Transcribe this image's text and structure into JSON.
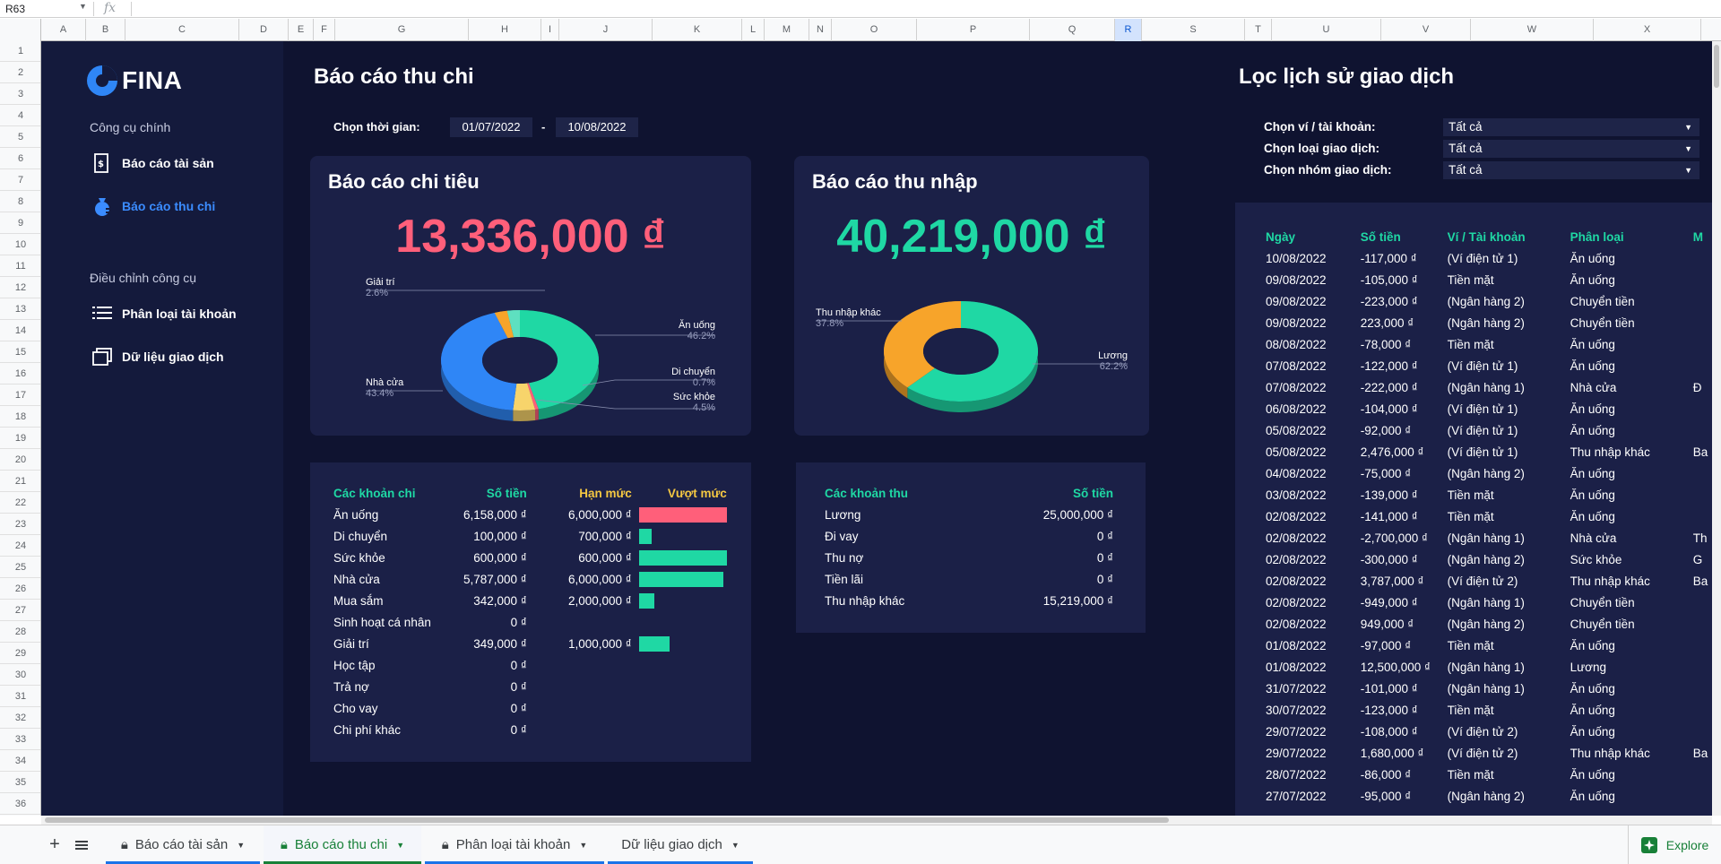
{
  "formula_bar": {
    "cell_ref": "R63",
    "fx": "fx"
  },
  "columns": [
    "A",
    "B",
    "C",
    "D",
    "E",
    "F",
    "G",
    "H",
    "I",
    "J",
    "K",
    "L",
    "M",
    "N",
    "O",
    "P",
    "Q",
    "R",
    "S",
    "T",
    "U",
    "V",
    "W",
    "X"
  ],
  "rows": [
    "1",
    "2",
    "3",
    "4",
    "5",
    "6",
    "7",
    "8",
    "9",
    "10",
    "11",
    "12",
    "13",
    "14",
    "15",
    "16",
    "17",
    "18",
    "19",
    "20",
    "21",
    "22",
    "23",
    "24",
    "25",
    "26",
    "27",
    "28",
    "29",
    "30",
    "31",
    "32",
    "33",
    "34",
    "35",
    "36"
  ],
  "sidebar": {
    "logo": "FINA",
    "section1": "Công cụ chính",
    "item_assets": "Báo cáo tài sản",
    "item_income_expense": "Báo cáo thu chi",
    "section2": "Điều chỉnh công cụ",
    "item_categories": "Phân loại tài khoản",
    "item_transactions": "Dữ liệu giao dịch"
  },
  "report": {
    "title": "Báo cáo thu chi",
    "time_label": "Chọn thời gian:",
    "date_from": "01/07/2022",
    "date_sep": "-",
    "date_to": "10/08/2022"
  },
  "expense_card": {
    "title": "Báo cáo chi tiêu",
    "total": "13,336,000 ₫",
    "color": "#ff5f7a",
    "slices": [
      {
        "name": "Ăn uống",
        "pct": "46.2%",
        "value": 46.2,
        "color": "#1fd8a4"
      },
      {
        "name": "Di chuyển",
        "pct": "0.7%",
        "value": 0.7,
        "color": "#ff5f7a"
      },
      {
        "name": "Sức khỏe",
        "pct": "4.5%",
        "value": 4.5,
        "color": "#f7d46b"
      },
      {
        "name": "Nhà cửa",
        "pct": "43.4%",
        "value": 43.4,
        "color": "#2f86f6"
      },
      {
        "name": "Giải trí",
        "pct": "2.6%",
        "value": 2.6,
        "color": "#f7a42a"
      },
      {
        "name": "",
        "pct": "",
        "value": 2.6,
        "color": "#5ee0c0"
      }
    ]
  },
  "income_card": {
    "title": "Báo cáo thu nhập",
    "total": "40,219,000 ₫",
    "color": "#1fd8a4",
    "slices": [
      {
        "name": "Lương",
        "pct": "62.2%",
        "value": 62.2,
        "color": "#1fd8a4"
      },
      {
        "name": "Thu nhập khác",
        "pct": "37.8%",
        "value": 37.8,
        "color": "#f7a42a"
      }
    ]
  },
  "expense_table": {
    "headers": [
      "Các khoản chi",
      "Số tiền",
      "Hạn mức",
      "Vượt mức"
    ],
    "rows": [
      {
        "name": "Ăn uống",
        "amount": "6,158,000 ₫",
        "limit": "6,000,000 ₫",
        "ratio": 1.0,
        "over": true
      },
      {
        "name": "Di chuyển",
        "amount": "100,000 ₫",
        "limit": "700,000 ₫",
        "ratio": 0.14,
        "over": false
      },
      {
        "name": "Sức khỏe",
        "amount": "600,000 ₫",
        "limit": "600,000 ₫",
        "ratio": 1.0,
        "over": false
      },
      {
        "name": "Nhà cửa",
        "amount": "5,787,000 ₫",
        "limit": "6,000,000 ₫",
        "ratio": 0.96,
        "over": false
      },
      {
        "name": "Mua sắm",
        "amount": "342,000 ₫",
        "limit": "2,000,000 ₫",
        "ratio": 0.17,
        "over": false
      },
      {
        "name": "Sinh hoạt cá nhân",
        "amount": "0 ₫",
        "limit": "",
        "ratio": 0,
        "over": false
      },
      {
        "name": "Giải trí",
        "amount": "349,000 ₫",
        "limit": "1,000,000 ₫",
        "ratio": 0.35,
        "over": false
      },
      {
        "name": "Học tập",
        "amount": "0 ₫",
        "limit": "",
        "ratio": 0,
        "over": false
      },
      {
        "name": "Trả nợ",
        "amount": "0 ₫",
        "limit": "",
        "ratio": 0,
        "over": false
      },
      {
        "name": "Cho vay",
        "amount": "0 ₫",
        "limit": "",
        "ratio": 0,
        "over": false
      },
      {
        "name": "Chi phí khác",
        "amount": "0 ₫",
        "limit": "",
        "ratio": 0,
        "over": false
      }
    ]
  },
  "income_table": {
    "headers": [
      "Các khoản thu",
      "Số tiền"
    ],
    "rows": [
      {
        "name": "Lương",
        "amount": "25,000,000 ₫"
      },
      {
        "name": "Đi vay",
        "amount": "0 ₫"
      },
      {
        "name": "Thu nợ",
        "amount": "0 ₫"
      },
      {
        "name": "Tiền lãi",
        "amount": "0 ₫"
      },
      {
        "name": "Thu nhập khác",
        "amount": "15,219,000 ₫"
      }
    ]
  },
  "filter": {
    "title": "Lọc lịch sử giao dịch",
    "wallet_label": "Chọn ví / tài khoản:",
    "wallet_value": "Tất cả",
    "type_label": "Chọn loại giao dịch:",
    "type_value": "Tất cả",
    "group_label": "Chọn nhóm giao dịch:",
    "group_value": "Tất cả"
  },
  "history": {
    "headers": [
      "Ngày",
      "Số tiền",
      "Ví / Tài khoản",
      "Phân loại",
      "M"
    ],
    "rows": [
      [
        "10/08/2022",
        "-117,000 ₫",
        "(Ví điện tử 1)",
        "Ăn uống",
        ""
      ],
      [
        "09/08/2022",
        "-105,000 ₫",
        "Tiền mặt",
        "Ăn uống",
        ""
      ],
      [
        "09/08/2022",
        "-223,000 ₫",
        "(Ngân hàng 2)",
        "Chuyển tiền",
        ""
      ],
      [
        "09/08/2022",
        "223,000 ₫",
        "(Ngân hàng 2)",
        "Chuyển tiền",
        ""
      ],
      [
        "08/08/2022",
        "-78,000 ₫",
        "Tiền mặt",
        "Ăn uống",
        ""
      ],
      [
        "07/08/2022",
        "-122,000 ₫",
        "(Ví điện tử 1)",
        "Ăn uống",
        ""
      ],
      [
        "07/08/2022",
        "-222,000 ₫",
        "(Ngân hàng 1)",
        "Nhà cửa",
        "Đ"
      ],
      [
        "06/08/2022",
        "-104,000 ₫",
        "(Ví điện tử 1)",
        "Ăn uống",
        ""
      ],
      [
        "05/08/2022",
        "-92,000 ₫",
        "(Ví điện tử 1)",
        "Ăn uống",
        ""
      ],
      [
        "05/08/2022",
        "2,476,000 ₫",
        "(Ví điện tử 1)",
        "Thu nhập khác",
        "Ba"
      ],
      [
        "04/08/2022",
        "-75,000 ₫",
        "(Ngân hàng 2)",
        "Ăn uống",
        ""
      ],
      [
        "03/08/2022",
        "-139,000 ₫",
        "Tiền mặt",
        "Ăn uống",
        ""
      ],
      [
        "02/08/2022",
        "-141,000 ₫",
        "Tiền mặt",
        "Ăn uống",
        ""
      ],
      [
        "02/08/2022",
        "-2,700,000 ₫",
        "(Ngân hàng 1)",
        "Nhà cửa",
        "Th"
      ],
      [
        "02/08/2022",
        "-300,000 ₫",
        "(Ngân hàng 2)",
        "Sức khỏe",
        "G"
      ],
      [
        "02/08/2022",
        "3,787,000 ₫",
        "(Ví điện tử 2)",
        "Thu nhập khác",
        "Ba"
      ],
      [
        "02/08/2022",
        "-949,000 ₫",
        "(Ngân hàng 1)",
        "Chuyển tiền",
        ""
      ],
      [
        "02/08/2022",
        "949,000 ₫",
        "(Ngân hàng 2)",
        "Chuyển tiền",
        ""
      ],
      [
        "01/08/2022",
        "-97,000 ₫",
        "Tiền mặt",
        "Ăn uống",
        ""
      ],
      [
        "01/08/2022",
        "12,500,000 ₫",
        "(Ngân hàng 1)",
        "Lương",
        ""
      ],
      [
        "31/07/2022",
        "-101,000 ₫",
        "(Ngân hàng 1)",
        "Ăn uống",
        ""
      ],
      [
        "30/07/2022",
        "-123,000 ₫",
        "Tiền mặt",
        "Ăn uống",
        ""
      ],
      [
        "29/07/2022",
        "-108,000 ₫",
        "(Ví điện tử 2)",
        "Ăn uống",
        ""
      ],
      [
        "29/07/2022",
        "1,680,000 ₫",
        "(Ví điện tử 2)",
        "Thu nhập khác",
        "Ba"
      ],
      [
        "28/07/2022",
        "-86,000 ₫",
        "Tiền mặt",
        "Ăn uống",
        ""
      ],
      [
        "27/07/2022",
        "-95,000 ₫",
        "(Ngân hàng 2)",
        "Ăn uống",
        ""
      ]
    ]
  },
  "tabs": [
    {
      "label": "Báo cáo tài sản"
    },
    {
      "label": "Báo cáo thu chi"
    },
    {
      "label": "Phân loại tài khoản"
    },
    {
      "label": "Dữ liệu giao dịch"
    }
  ],
  "explore": "Explore"
}
